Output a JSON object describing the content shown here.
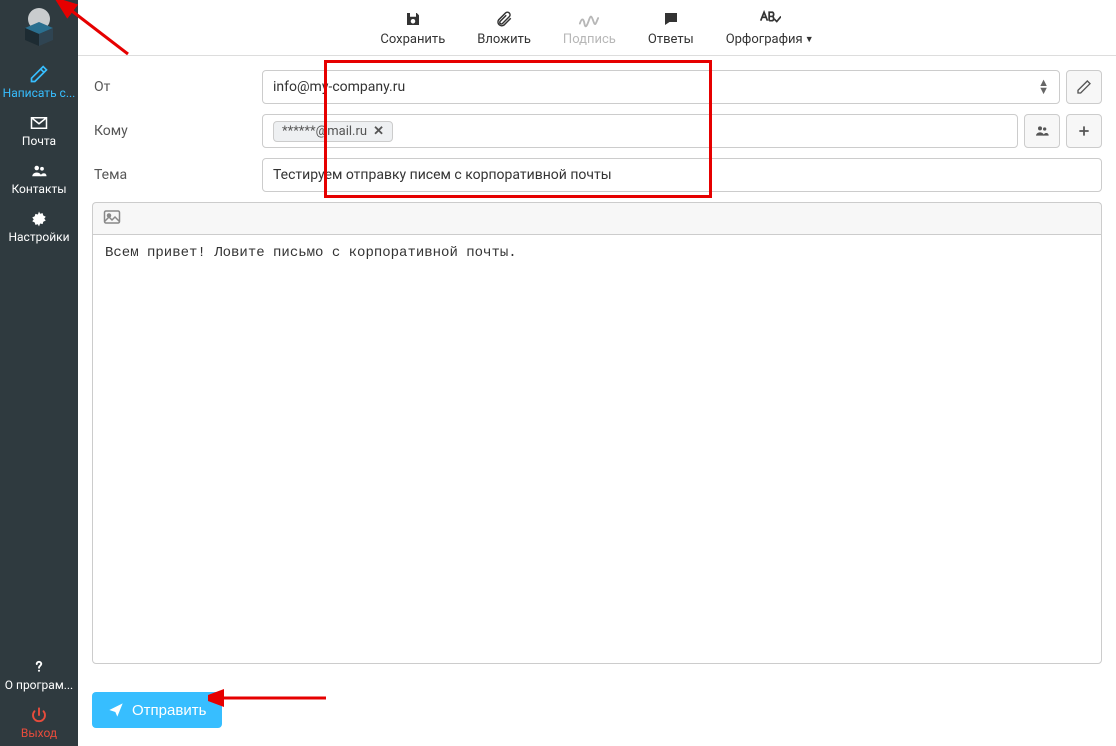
{
  "sidebar": {
    "items": [
      {
        "label": "Написать с...",
        "active": true
      },
      {
        "label": "Почта"
      },
      {
        "label": "Контакты"
      },
      {
        "label": "Настройки"
      }
    ],
    "footer": [
      {
        "label": "О програм..."
      },
      {
        "label": "Выход"
      }
    ]
  },
  "toolbar": {
    "save": "Сохранить",
    "attach": "Вложить",
    "signature": "Подпись",
    "replies": "Ответы",
    "spelling": "Орфография"
  },
  "compose": {
    "from_label": "От",
    "from_value": "info@my-company.ru",
    "to_label": "Кому",
    "to_chip": "******@mail.ru",
    "subject_label": "Тема",
    "subject_value": "Тестируем отправку писем с корпоративной почты",
    "body": "Всем привет! Ловите письмо с корпоративной почты."
  },
  "actions": {
    "send": "Отправить"
  }
}
